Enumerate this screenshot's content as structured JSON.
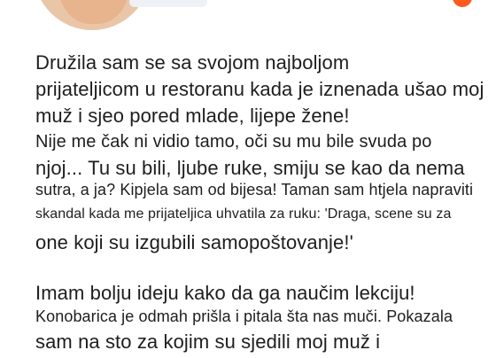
{
  "post": {
    "lines": [
      "Družila sam se sa svojom najboljom",
      "prijateljicom u restoranu kada je iznenada ušao moj",
      "muž i sjeo pored mlade, lijepe žene!",
      "Nije me čak ni vidio tamo, oči su mu bile svuda po",
      "njoj... Tu su bili, ljube ruke, smiju se kao da nema",
      "sutra, a ja? Kipjela sam od bijesa! Taman sam htjela napraviti",
      "skandal kada me prijateljica uhvatila za ruku: 'Draga, scene su za",
      "one koji su izgubili samopoštovanje!'",
      "Imam bolju ideju kako da ga naučim lekciju!",
      "Konobarica je odmah prišla i pitala šta nas muči. Pokazala",
      "sam na sto za kojim su sjedili moj muž i"
    ]
  }
}
